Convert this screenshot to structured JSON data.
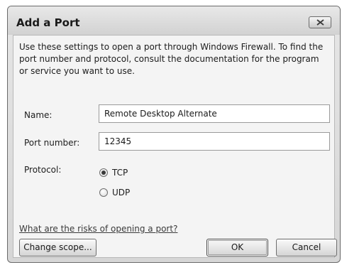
{
  "dialog": {
    "title": "Add a Port",
    "description": "Use these settings to open a port through Windows Firewall. To find the port number and protocol, consult the documentation for the program or service you want to use."
  },
  "icons": {
    "close": "close-icon"
  },
  "form": {
    "name_label": "Name:",
    "name_value": "Remote Desktop Alternate",
    "port_label": "Port number:",
    "port_value": "12345",
    "protocol_label": "Protocol:",
    "protocol_options": [
      {
        "label": "TCP",
        "selected": true
      },
      {
        "label": "UDP",
        "selected": false
      }
    ]
  },
  "footer": {
    "risk_link": "What are the risks of opening a port?",
    "change_scope_label": "Change scope...",
    "ok_label": "OK",
    "cancel_label": "Cancel"
  }
}
